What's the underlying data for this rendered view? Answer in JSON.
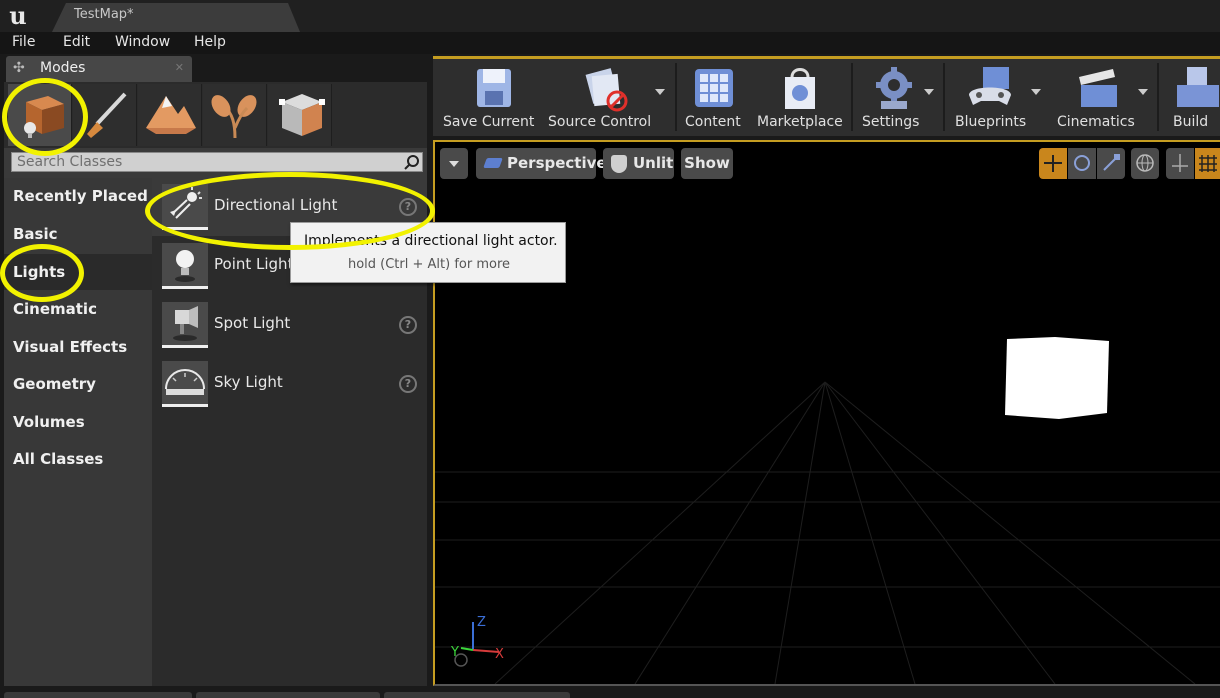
{
  "window": {
    "tab_title": "TestMap*"
  },
  "menu": {
    "items": [
      "File",
      "Edit",
      "Window",
      "Help"
    ]
  },
  "modes_panel": {
    "tab_label": "Modes",
    "mode_icons": [
      "place-mode-icon",
      "paint-mode-icon",
      "landscape-mode-icon",
      "foliage-mode-icon",
      "geometry-mode-icon"
    ],
    "search_placeholder": "Search Classes",
    "categories": [
      "Recently Placed",
      "Basic",
      "Lights",
      "Cinematic",
      "Visual Effects",
      "Geometry",
      "Volumes",
      "All Classes"
    ],
    "selected_category": "Lights",
    "items": [
      {
        "label": "Directional Light",
        "icon": "directional-light-icon"
      },
      {
        "label": "Point Light",
        "icon": "point-light-icon"
      },
      {
        "label": "Spot Light",
        "icon": "spot-light-icon"
      },
      {
        "label": "Sky Light",
        "icon": "sky-light-icon"
      }
    ]
  },
  "tooltip": {
    "text": "Implements a directional light actor.",
    "hint": "hold (Ctrl + Alt) for more"
  },
  "toolbar": {
    "buttons": [
      {
        "label": "Save Current",
        "icon": "save-icon"
      },
      {
        "label": "Source Control",
        "icon": "source-control-icon"
      },
      {
        "label": "Content",
        "icon": "content-icon"
      },
      {
        "label": "Marketplace",
        "icon": "marketplace-icon"
      },
      {
        "label": "Settings",
        "icon": "settings-icon"
      },
      {
        "label": "Blueprints",
        "icon": "blueprints-icon"
      },
      {
        "label": "Cinematics",
        "icon": "cinematics-icon"
      },
      {
        "label": "Build",
        "icon": "build-icon"
      }
    ]
  },
  "viewport": {
    "perspective_label": "Perspective",
    "view_mode_label": "Unlit",
    "show_label": "Show",
    "axes": {
      "x": "X",
      "y": "Y",
      "z": "Z"
    }
  },
  "colors": {
    "highlight": "#f2f200",
    "accent": "#c59d21"
  }
}
